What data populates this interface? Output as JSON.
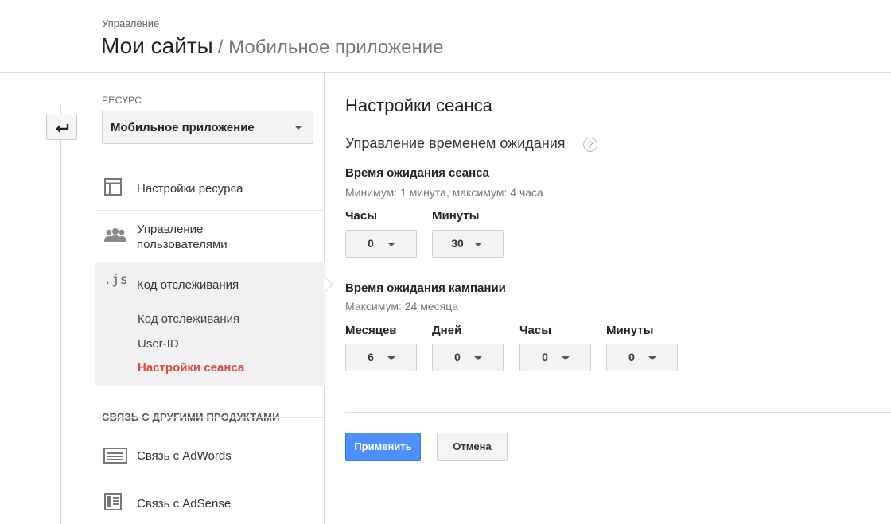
{
  "header": {
    "crumb": "Управление",
    "title": "Мои сайты",
    "subtitle": "/ Мобильное приложение"
  },
  "sidebar": {
    "resource_label": "РЕСУРС",
    "resource_value": "Мобильное приложение",
    "items": [
      {
        "label": "Настройки ресурса",
        "icon": "property-settings-icon"
      },
      {
        "label": "Управление пользователями",
        "icon": "users-icon"
      },
      {
        "label": "Код отслеживания",
        "icon": "js-icon"
      }
    ],
    "tracking_subitems": [
      "Код отслеживания",
      "User-ID",
      "Настройки сеанса"
    ],
    "active_subitem": "Настройки сеанса",
    "section_label": "СВЯЗЬ С ДРУГИМИ ПРОДУКТАМИ",
    "link_items": [
      {
        "label": "Связь с AdWords",
        "icon": "adwords-icon"
      },
      {
        "label": "Связь с AdSense",
        "icon": "adsense-icon"
      }
    ]
  },
  "main": {
    "title": "Настройки сеанса",
    "timeout_heading": "Управление временем ожидания",
    "help_symbol": "?",
    "session": {
      "label": "Время ожидания сеанса",
      "hint": "Минимум: 1 минута, максимум: 4 часа",
      "hours_label": "Часы",
      "hours_value": "0",
      "minutes_label": "Минуты",
      "minutes_value": "30"
    },
    "campaign": {
      "label": "Время ожидания кампании",
      "hint": "Максимум: 24 месяца",
      "months_label": "Месяцев",
      "months_value": "6",
      "days_label": "Дней",
      "days_value": "0",
      "hours_label": "Часы",
      "hours_value": "0",
      "minutes_label": "Минуты",
      "minutes_value": "0"
    },
    "apply_label": "Применить",
    "cancel_label": "Отмена"
  },
  "colors": {
    "accent_blue": "#4d90fe",
    "active_red": "#dd4b39"
  }
}
